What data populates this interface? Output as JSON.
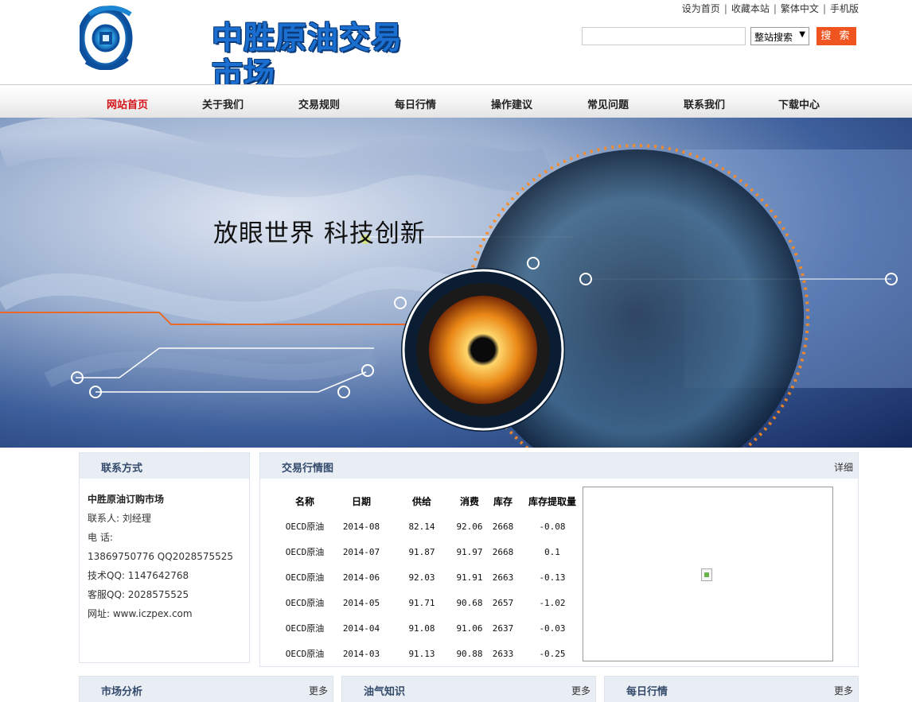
{
  "header": {
    "logo_text": "中胜原油交易市场",
    "toplinks": [
      "设为首页",
      "收藏本站",
      "繁体中文",
      "手机版"
    ],
    "search": {
      "placeholder": "",
      "scope": "整站搜索",
      "button": "搜 索"
    }
  },
  "nav": {
    "items": [
      "网站首页",
      "关于我们",
      "交易规则",
      "每日行情",
      "操作建议",
      "常见问题",
      "联系我们",
      "下载中心"
    ],
    "active_index": 0
  },
  "banner": {
    "slogan": "放眼世界  科技创新"
  },
  "contact": {
    "title": "联系方式",
    "company": "中胜原油订购市场",
    "person": "联系人: 刘经理",
    "phone_label": "电  话:",
    "phone": "13869750776 QQ2028575525",
    "tech_qq": "技术QQ: 1147642768",
    "service_qq": "客服QQ: 2028575525",
    "website": "网址: www.iczpex.com"
  },
  "market": {
    "title": "交易行情图",
    "more": "详细",
    "columns": [
      "名称",
      "日期",
      "供给",
      "消费",
      "库存",
      "库存提取量"
    ],
    "rows": [
      [
        "OECD原油",
        "2014-08",
        "82.14",
        "92.06",
        "2668",
        "-0.08"
      ],
      [
        "OECD原油",
        "2014-07",
        "91.87",
        "91.97",
        "2668",
        "0.1"
      ],
      [
        "OECD原油",
        "2014-06",
        "92.03",
        "91.91",
        "2663",
        "-0.13"
      ],
      [
        "OECD原油",
        "2014-05",
        "91.71",
        "90.68",
        "2657",
        "-1.02"
      ],
      [
        "OECD原油",
        "2014-04",
        "91.08",
        "91.06",
        "2637",
        "-0.03"
      ],
      [
        "OECD原油",
        "2014-03",
        "91.13",
        "90.88",
        "2633",
        "-0.25"
      ]
    ]
  },
  "bottom_panels": [
    {
      "title": "市场分析",
      "more": "更多"
    },
    {
      "title": "油气知识",
      "more": "更多"
    },
    {
      "title": "每日行情",
      "more": "更多"
    }
  ],
  "colors": {
    "accent": "#f0541e",
    "nav_active": "#d4141a",
    "panel_head": "#e9eef5",
    "logo_blue": "#1a6fd0"
  }
}
